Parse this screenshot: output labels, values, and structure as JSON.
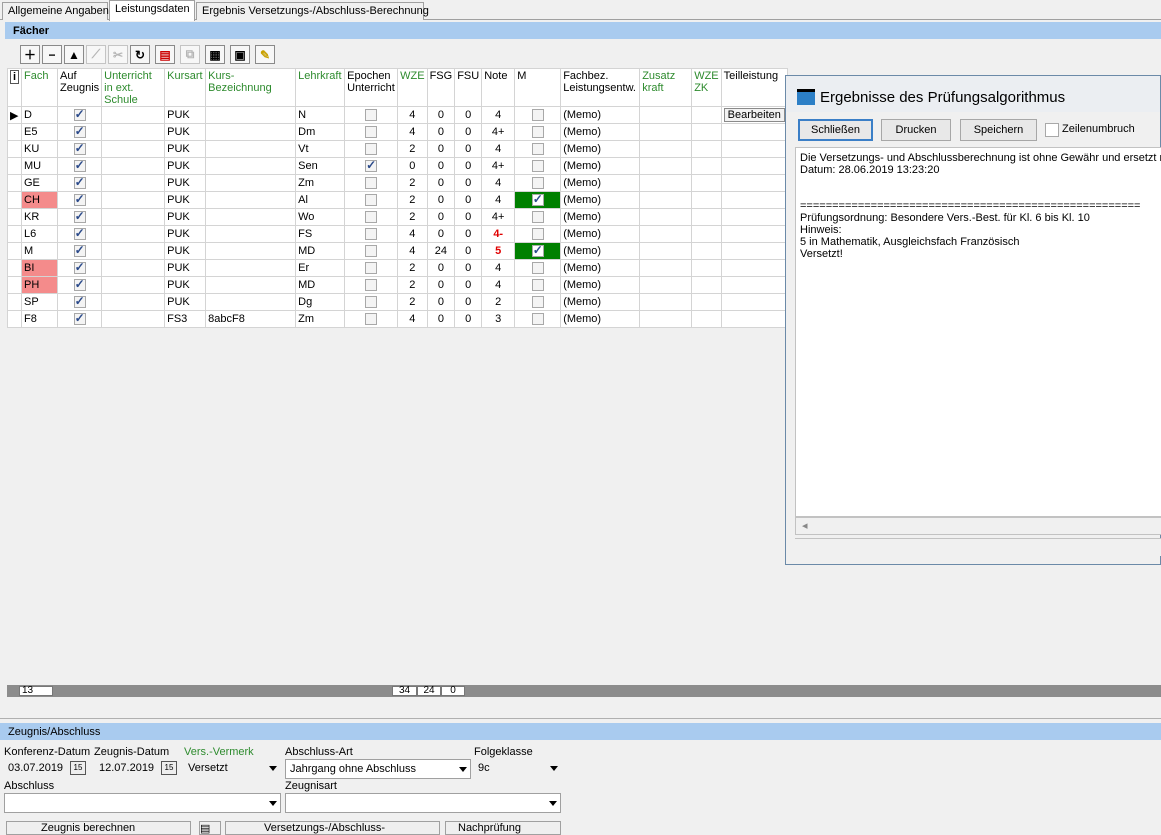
{
  "tabs": [
    {
      "label": "Allgemeine Angaben"
    },
    {
      "label": "Leistungsdaten"
    },
    {
      "label": "Ergebnis Versetzungs-/Abschluss-Berechnung"
    }
  ],
  "faecher_title": "Fächer",
  "toolbar_icons": [
    "add-icon",
    "remove-icon",
    "move-up-icon",
    "chart-icon",
    "cut-icon",
    "refresh-icon",
    "document-delete-icon",
    "copy-icon",
    "notes-icon",
    "calculator-icon",
    "pencil-icon"
  ],
  "info_glyph": "i",
  "grid": {
    "headers": {
      "fach": "Fach",
      "auf_zeugnis": "Auf Zeugnis",
      "ext_schule": "Unterricht in ext. Schule",
      "kursart": "Kursart",
      "kursbez": "Kurs-Bezeichnung",
      "lehrkraft": "Lehrkraft",
      "epochen": "Epochen Unterricht",
      "wze": "WZE",
      "fsg": "FSG",
      "fsu": "FSU",
      "note": "Note",
      "m": "M",
      "fachbez": "Fachbez. Leistungsentw.",
      "zusatzkraft": "Zusatz kraft",
      "wze_zk": "WZE ZK",
      "teilleistung": "Teilleistung"
    },
    "edit_button": "Bearbeiten",
    "rows": [
      {
        "fach": "D",
        "kursart": "PUK",
        "kursbez": "",
        "lehrkraft": "N",
        "epochen": false,
        "wze": "4",
        "fsg": "0",
        "fsu": "0",
        "note": "4",
        "m": false,
        "memo": "(Memo)"
      },
      {
        "fach": "E5",
        "kursart": "PUK",
        "kursbez": "",
        "lehrkraft": "Dm",
        "epochen": false,
        "wze": "4",
        "fsg": "0",
        "fsu": "0",
        "note": "4+",
        "m": false,
        "memo": "(Memo)"
      },
      {
        "fach": "KU",
        "kursart": "PUK",
        "kursbez": "",
        "lehrkraft": "Vt",
        "epochen": false,
        "wze": "2",
        "fsg": "0",
        "fsu": "0",
        "note": "4",
        "m": false,
        "memo": "(Memo)"
      },
      {
        "fach": "MU",
        "kursart": "PUK",
        "kursbez": "",
        "lehrkraft": "Sen",
        "epochen": true,
        "wze": "0",
        "fsg": "0",
        "fsu": "0",
        "note": "4+",
        "m": false,
        "memo": "(Memo)"
      },
      {
        "fach": "GE",
        "kursart": "PUK",
        "kursbez": "",
        "lehrkraft": "Zm",
        "epochen": false,
        "wze": "2",
        "fsg": "0",
        "fsu": "0",
        "note": "4",
        "m": false,
        "memo": "(Memo)"
      },
      {
        "fach": "CH",
        "kursart": "PUK",
        "kursbez": "",
        "lehrkraft": "Al",
        "epochen": false,
        "wze": "2",
        "fsg": "0",
        "fsu": "0",
        "note": "4",
        "m": true,
        "memo": "(Memo)"
      },
      {
        "fach": "KR",
        "kursart": "PUK",
        "kursbez": "",
        "lehrkraft": "Wo",
        "epochen": false,
        "wze": "2",
        "fsg": "0",
        "fsu": "0",
        "note": "4+",
        "m": false,
        "memo": "(Memo)"
      },
      {
        "fach": "L6",
        "kursart": "PUK",
        "kursbez": "",
        "lehrkraft": "FS",
        "epochen": false,
        "wze": "4",
        "fsg": "0",
        "fsu": "0",
        "note": "4-",
        "m": false,
        "memo": "(Memo)"
      },
      {
        "fach": "M",
        "kursart": "PUK",
        "kursbez": "",
        "lehrkraft": "MD",
        "epochen": false,
        "wze": "4",
        "fsg": "24",
        "fsu": "0",
        "note": "5",
        "m": true,
        "memo": "(Memo)"
      },
      {
        "fach": "BI",
        "kursart": "PUK",
        "kursbez": "",
        "lehrkraft": "Er",
        "epochen": false,
        "wze": "2",
        "fsg": "0",
        "fsu": "0",
        "note": "4",
        "m": false,
        "memo": "(Memo)"
      },
      {
        "fach": "PH",
        "kursart": "PUK",
        "kursbez": "",
        "lehrkraft": "MD",
        "epochen": false,
        "wze": "2",
        "fsg": "0",
        "fsu": "0",
        "note": "4",
        "m": false,
        "memo": "(Memo)"
      },
      {
        "fach": "SP",
        "kursart": "PUK",
        "kursbez": "",
        "lehrkraft": "Dg",
        "epochen": false,
        "wze": "2",
        "fsg": "0",
        "fsu": "0",
        "note": "2",
        "m": false,
        "memo": "(Memo)"
      },
      {
        "fach": "F8",
        "kursart": "FS3",
        "kursbez": "8abcF8",
        "lehrkraft": "Zm",
        "epochen": false,
        "wze": "4",
        "fsg": "0",
        "fsu": "0",
        "note": "3",
        "m": false,
        "memo": "(Memo)"
      }
    ],
    "totals": {
      "count": "13",
      "wze": "34",
      "fsg": "24",
      "fsu": "0"
    }
  },
  "dialog": {
    "title": "Ergebnisse des Prüfungsalgorithmus",
    "btn_close": "Schließen",
    "btn_print": "Drucken",
    "btn_save": "Speichern",
    "wrap_label": "Zeilenumbruch",
    "lines": [
      "Die Versetzungs- und Abschlussberechnung ist ohne Gewähr und ersetzt nic",
      "Datum: 28.06.2019 13:23:20",
      "",
      "",
      "=====================================================",
      "Prüfungsordnung: Besondere Vers.-Best. für Kl. 6 bis Kl. 10",
      "Hinweis:",
      "5 in Mathematik, Ausgleichsfach Französisch",
      "Versetzt!"
    ],
    "scroll_left": "◂"
  },
  "zeugnis": {
    "title": "Zeugnis/Abschluss",
    "konferenz_label": "Konferenz-Datum",
    "konferenz_value": "03.07.2019",
    "zeugnis_label": "Zeugnis-Datum",
    "zeugnis_value": "12.07.2019",
    "vermerk_label": "Vers.-Vermerk",
    "vermerk_value": "Versetzt",
    "abschlussart_label": "Abschluss-Art",
    "abschlussart_value": "Jahrgang ohne Abschluss",
    "folgeklasse_label": "Folgeklasse",
    "folgeklasse_value": "9c",
    "abschluss_label": "Abschluss",
    "abschluss_value": "",
    "zeugnisart_label": "Zeugnisart",
    "zeugnisart_value": "",
    "cal_glyph": "15",
    "btn_zeugnis": "Zeugnis berechnen",
    "btn_versetzung": "Versetzungs-/Abschluss-Berechnung",
    "btn_nachpruefung": "Nachprüfung"
  },
  "colors": {
    "accent": "#a9cbef",
    "fail_bg": "#f48b8b",
    "m_bg": "#008000",
    "grade_fail": "#e00000",
    "green_header": "#2e8b2e"
  }
}
